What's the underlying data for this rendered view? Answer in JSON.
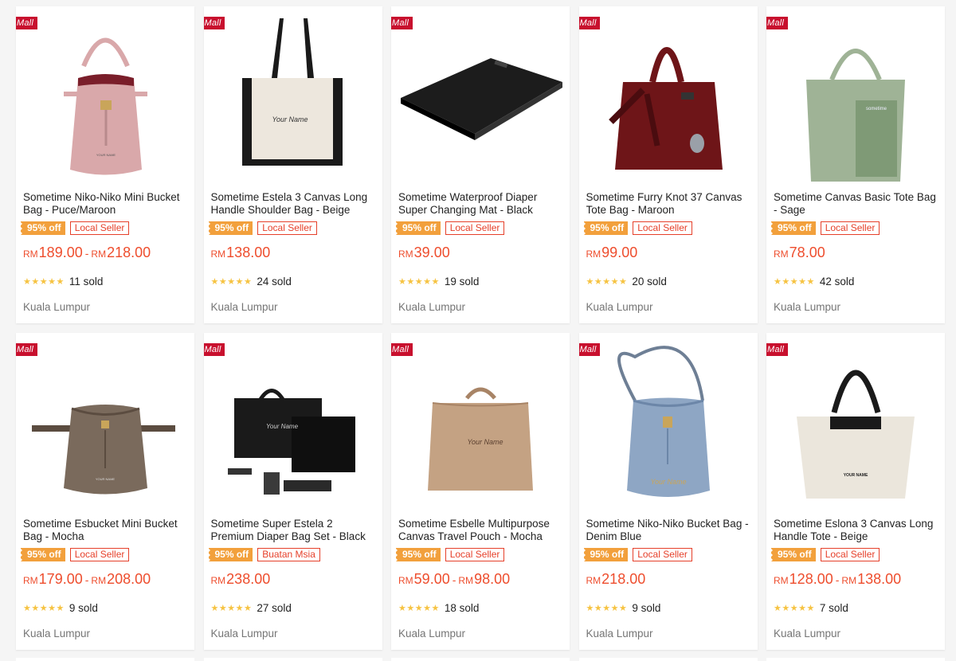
{
  "badges": {
    "mall": "Mall",
    "discount": "95% off"
  },
  "products": [
    {
      "title": "Sometime Niko-Niko Mini Bucket Bag - Puce/Maroon",
      "seller": "Local Seller",
      "price_low": "189.00",
      "price_high": "218.00",
      "currency": "RM",
      "rating": 5,
      "sold": "11 sold",
      "location": "Kuala Lumpur",
      "image": "bucket-bag-pink",
      "colors": {
        "main": "#d9a8aa",
        "accent": "#7a1e2a"
      }
    },
    {
      "title": "Sometime Estela 3 Canvas Long Handle Shoulder Bag - Beige",
      "seller": "Local Seller",
      "price_low": "138.00",
      "price_high": null,
      "currency": "RM",
      "rating": 5,
      "sold": "24 sold",
      "location": "Kuala Lumpur",
      "image": "tote-beige-black",
      "colors": {
        "main": "#ede7dd",
        "accent": "#1a1a1a"
      }
    },
    {
      "title": "Sometime Waterproof Diaper Super Changing Mat - Black",
      "seller": "Local Seller",
      "price_low": "39.00",
      "price_high": null,
      "currency": "RM",
      "rating": 5,
      "sold": "19 sold",
      "location": "Kuala Lumpur",
      "image": "changing-mat-black",
      "colors": {
        "main": "#1c1c1c",
        "accent": "#333333"
      }
    },
    {
      "title": "Sometime Furry Knot 37 Canvas Tote Bag - Maroon",
      "seller": "Local Seller",
      "price_low": "99.00",
      "price_high": null,
      "currency": "RM",
      "rating": 5,
      "sold": "20 sold",
      "location": "Kuala Lumpur",
      "image": "tote-maroon",
      "colors": {
        "main": "#6e1518",
        "accent": "#4a0c0f"
      }
    },
    {
      "title": "Sometime Canvas Basic Tote Bag - Sage",
      "seller": "Local Seller",
      "price_low": "78.00",
      "price_high": null,
      "currency": "RM",
      "rating": 5,
      "sold": "42 sold",
      "location": "Kuala Lumpur",
      "image": "tote-sage",
      "colors": {
        "main": "#9fb396",
        "accent": "#7f9a76"
      }
    },
    {
      "title": "Sometime Esbucket Mini Bucket Bag - Mocha",
      "seller": "Local Seller",
      "price_low": "179.00",
      "price_high": "208.00",
      "currency": "RM",
      "rating": 5,
      "sold": "9 sold",
      "location": "Kuala Lumpur",
      "image": "bucket-bag-mocha",
      "colors": {
        "main": "#7a6a5c",
        "accent": "#5b4c40"
      }
    },
    {
      "title": "Sometime Super Estela 2 Premium Diaper Bag Set - Black",
      "seller": "Buatan Msia",
      "price_low": "238.00",
      "price_high": null,
      "currency": "RM",
      "rating": 5,
      "sold": "27 sold",
      "location": "Kuala Lumpur",
      "image": "diaper-bag-set-black",
      "colors": {
        "main": "#1a1a1a",
        "accent": "#333333"
      }
    },
    {
      "title": "Sometime Esbelle Multipurpose Canvas Travel Pouch - Mocha",
      "seller": "Local Seller",
      "price_low": "59.00",
      "price_high": "98.00",
      "currency": "RM",
      "rating": 5,
      "sold": "18 sold",
      "location": "Kuala Lumpur",
      "image": "travel-pouch-mocha",
      "colors": {
        "main": "#c4a283",
        "accent": "#a88466"
      }
    },
    {
      "title": "Sometime Niko-Niko Bucket Bag - Denim Blue",
      "seller": "Local Seller",
      "price_low": "218.00",
      "price_high": null,
      "currency": "RM",
      "rating": 5,
      "sold": "9 sold",
      "location": "Kuala Lumpur",
      "image": "bucket-bag-denim",
      "colors": {
        "main": "#8ea6c4",
        "accent": "#6c86a8"
      }
    },
    {
      "title": "Sometime Eslona 3 Canvas Long Handle Tote - Beige",
      "seller": "Local Seller",
      "price_low": "128.00",
      "price_high": "138.00",
      "currency": "RM",
      "rating": 5,
      "sold": "7 sold",
      "location": "Kuala Lumpur",
      "image": "tote-beige-long-handle",
      "colors": {
        "main": "#ebe6dc",
        "accent": "#1a1a1a"
      }
    }
  ],
  "image_text": {
    "your_name": "Your Name",
    "your_name_caps": "YOUR NAME",
    "brand": "sometime"
  }
}
